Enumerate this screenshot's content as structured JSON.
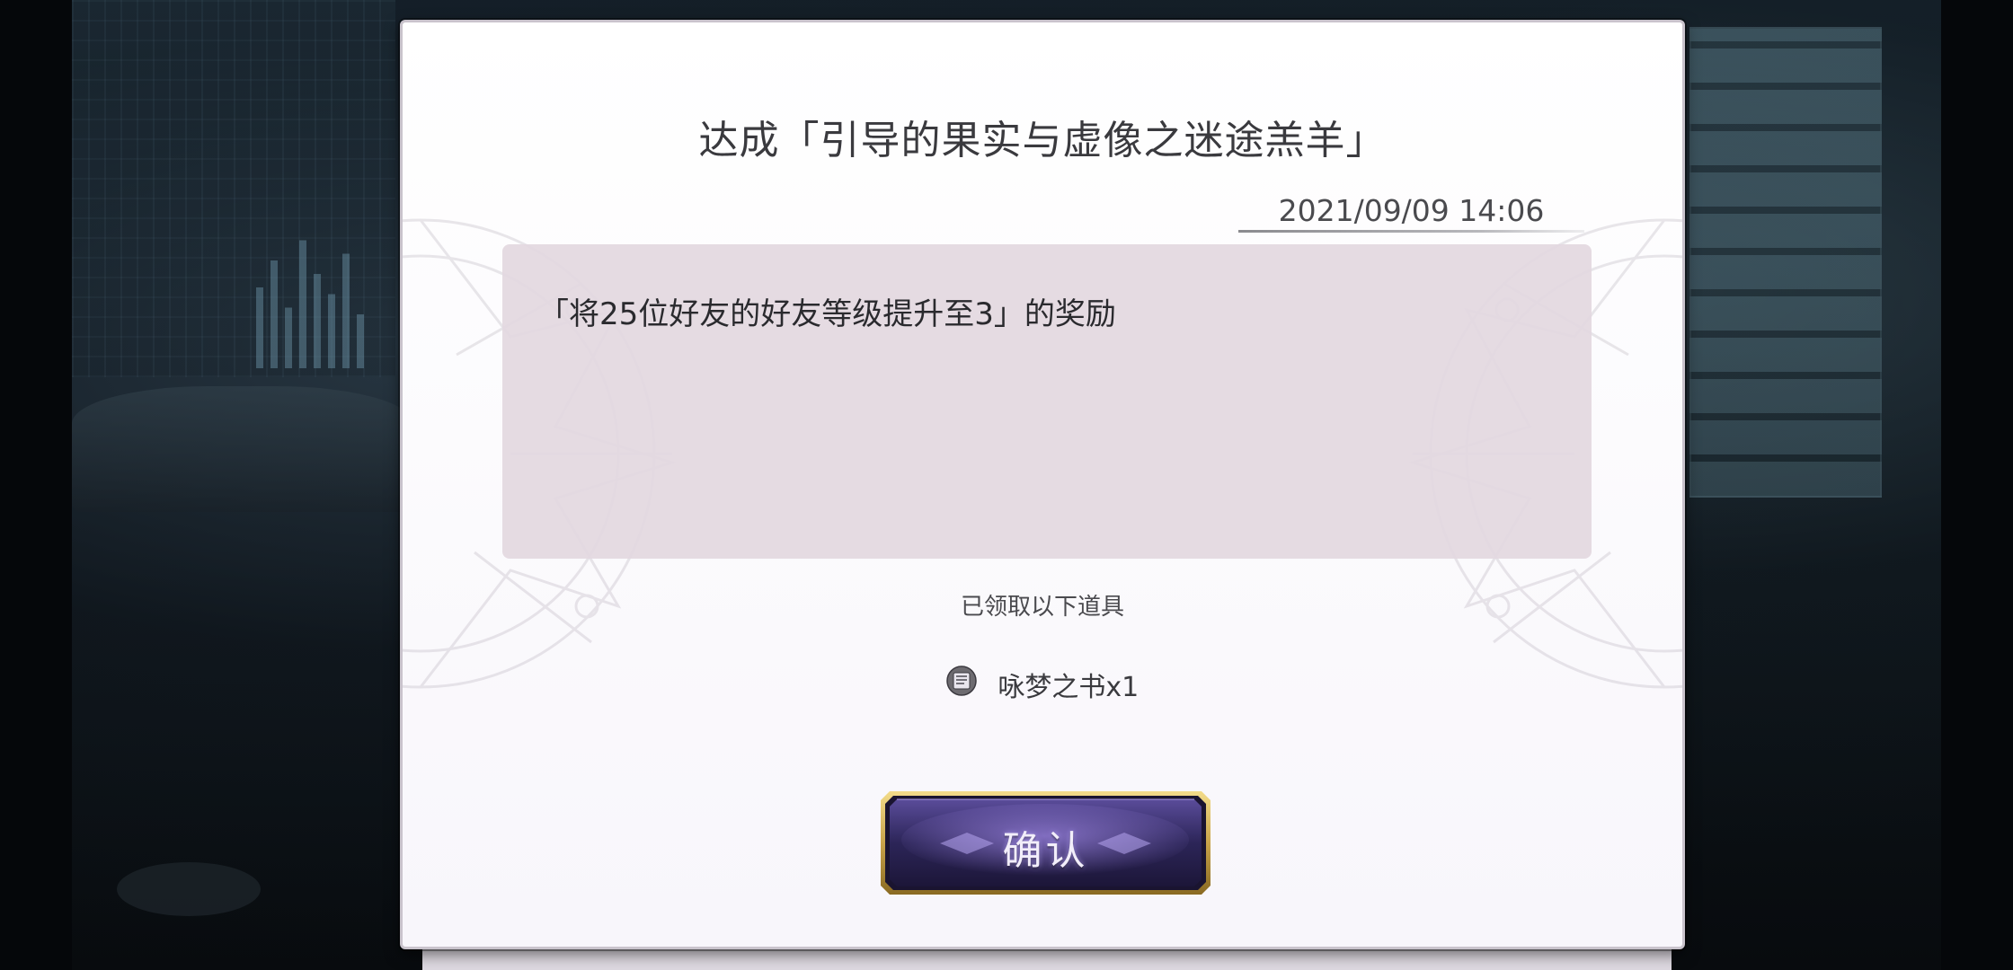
{
  "dialog": {
    "title": "达成「引导的果实与虚像之迷途羔羊」",
    "date": "2021/09/09 14:06",
    "message": "「将25位好友的好友等级提升至3」的奖励",
    "received_label": "已领取以下道具",
    "reward": {
      "icon": "book-icon",
      "label": "咏梦之书x1"
    },
    "confirm_label": "确认"
  },
  "colors": {
    "dialog_bg": "#ffffff",
    "message_box_bg": "#e3d8e0",
    "button_gold": "#c9a44a",
    "button_purple": "#3b2f6e"
  }
}
